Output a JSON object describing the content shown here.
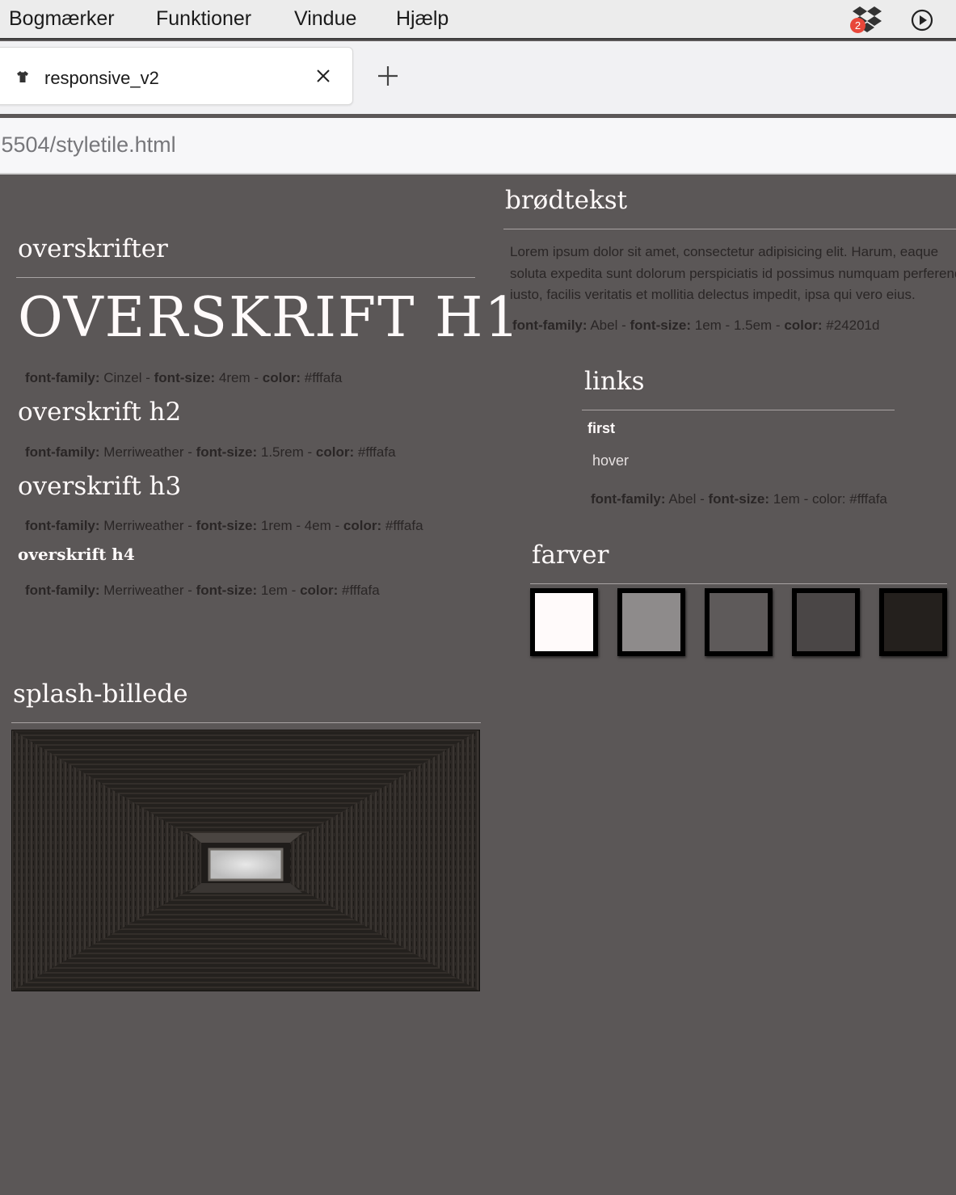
{
  "menubar": {
    "items": [
      "Bogmærker",
      "Funktioner",
      "Vindue",
      "Hjælp"
    ],
    "dropbox_badge": "2"
  },
  "tab": {
    "title": "responsive_v2"
  },
  "address_bar": {
    "url": ":5504/styletile.html"
  },
  "headings_section": {
    "title": "overskrifter",
    "h1": {
      "text": "OVERSKRIFT H1",
      "meta_family_label": "font-family:",
      "meta_family": "Cinzel",
      "meta_size_label": "font-size:",
      "meta_size": "4rem",
      "meta_color_label": "color:",
      "meta_color": "#fffafa"
    },
    "h2": {
      "text": "overskrift h2",
      "meta_family_label": "font-family:",
      "meta_family": "Merriweather",
      "meta_size_label": "font-size:",
      "meta_size": "1.5rem",
      "meta_color_label": "color:",
      "meta_color": "#fffafa"
    },
    "h3": {
      "text": "overskrift h3",
      "meta_family_label": "font-family:",
      "meta_family": "Merriweather",
      "meta_size_label": "font-size:",
      "meta_size": "1rem - 4em",
      "meta_color_label": "color:",
      "meta_color": "#fffafa"
    },
    "h4": {
      "text": "overskrift h4",
      "meta_family_label": "font-family:",
      "meta_family": "Merriweather",
      "meta_size_label": "font-size:",
      "meta_size": "1em",
      "meta_color_label": "color:",
      "meta_color": "#fffafa"
    }
  },
  "body_section": {
    "title": "brødtekst",
    "lines": [
      "Lorem ipsum dolor sit amet, consectetur adipisicing elit. Harum, eaque",
      "soluta expedita sunt dolorum perspiciatis id possimus numquam perferendis",
      "iusto, facilis veritatis et mollitia delectus impedit, ipsa qui vero eius."
    ],
    "meta_family_label": "font-family:",
    "meta_family": "Abel",
    "meta_size_label": "font-size:",
    "meta_size": "1em - 1.5em",
    "meta_color_label": "color:",
    "meta_color": "#24201d"
  },
  "links_section": {
    "title": "links",
    "first": "first",
    "hover": "hover",
    "meta_family_label": "font-family:",
    "meta_family": "Abel",
    "meta_size_label": "font-size:",
    "meta_size": "1em",
    "meta_color_text": "color: #fffafa"
  },
  "colors_section": {
    "title": "farver",
    "swatches": [
      "#fffafa",
      "#8e8b8b",
      "#5e5a5a",
      "#4a4646",
      "#24201d"
    ]
  },
  "splash_section": {
    "title": "splash-billede"
  },
  "colors": {
    "page_bg": "#5b5757",
    "text_light": "#fffafa",
    "text_dark": "#2a2626"
  }
}
